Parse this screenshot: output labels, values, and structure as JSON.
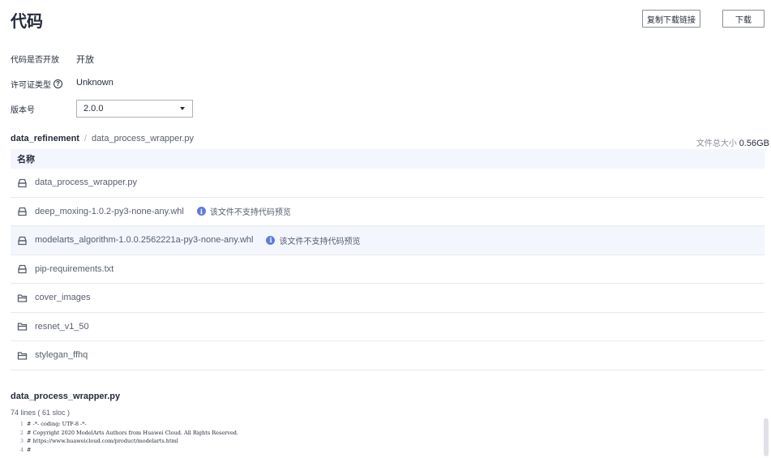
{
  "page": {
    "title": "代码"
  },
  "actions": {
    "copy_link": "复制下载链接",
    "download": "下载"
  },
  "fields": {
    "open_source_label": "代码是否开放",
    "open_source_value": "开放",
    "license_label": "许可证类型",
    "license_value": "Unknown",
    "version_label": "版本号",
    "version_value": "2.0.0"
  },
  "breadcrumb": {
    "root": "data_refinement",
    "separator": "/",
    "file": "data_process_wrapper.py"
  },
  "total_size": {
    "label": "文件总大小",
    "value": "0.56GB"
  },
  "table": {
    "header": "名称",
    "rows": [
      {
        "name": "data_process_wrapper.py",
        "type": "file",
        "note": ""
      },
      {
        "name": "deep_moxing-1.0.2-py3-none-any.whl",
        "type": "file",
        "note": "该文件不支持代码预览"
      },
      {
        "name": "modelarts_algorithm-1.0.0.2562221a-py3-none-any.whl",
        "type": "file",
        "note": "该文件不支持代码预览"
      },
      {
        "name": "pip-requirements.txt",
        "type": "file",
        "note": ""
      },
      {
        "name": "cover_images",
        "type": "folder",
        "note": ""
      },
      {
        "name": "resnet_v1_50",
        "type": "folder",
        "note": ""
      },
      {
        "name": "stylegan_ffhq",
        "type": "folder",
        "note": ""
      }
    ]
  },
  "code_view": {
    "filename": "data_process_wrapper.py",
    "line_count": "74 lines ( 61 sloc )",
    "lines": [
      {
        "n": "1",
        "text": "# -*- coding: UTF-8 -*-"
      },
      {
        "n": "2",
        "text": "# Copyright 2020 ModelArts Authors from Huawei Cloud. All Rights Reserved."
      },
      {
        "n": "3",
        "text": "# https://www.huaweicloud.com/product/modelarts.html"
      },
      {
        "n": "4",
        "text": "#"
      }
    ]
  },
  "colors": {
    "accent": "#5e7ce0",
    "header_bg": "#f3f6fd",
    "border": "#e8e9ec"
  }
}
